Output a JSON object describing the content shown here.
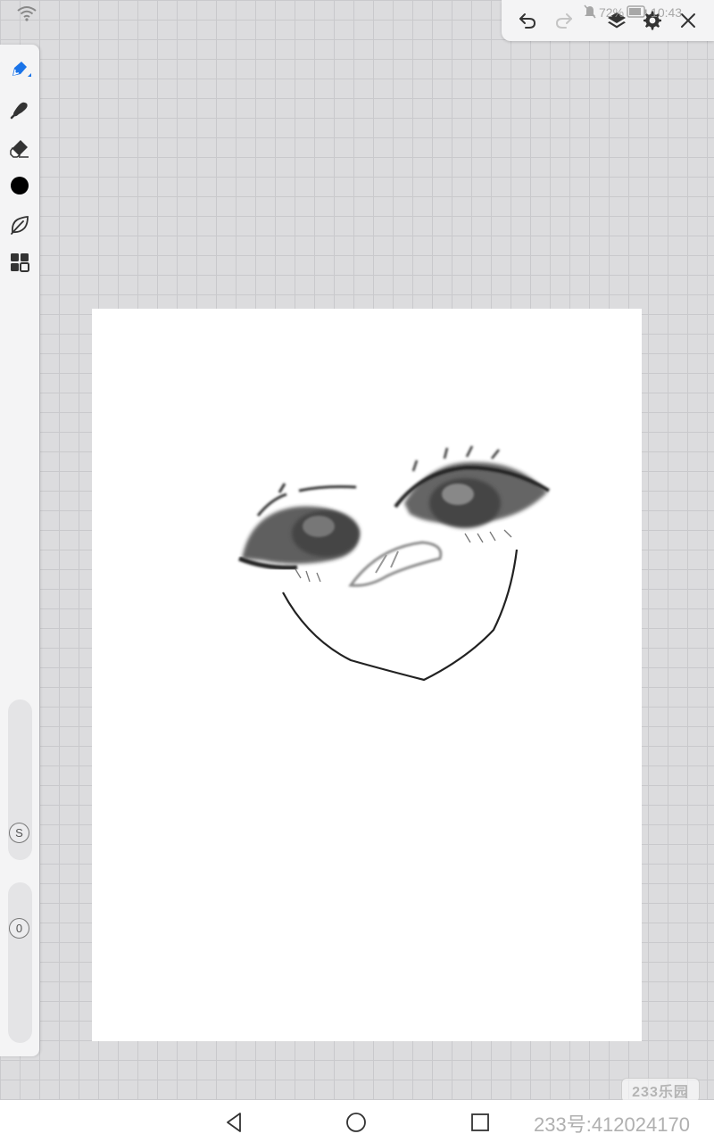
{
  "status_bar": {
    "battery": "72%",
    "time": "10:43"
  },
  "toolbar": {
    "icons": [
      "undo-icon",
      "redo-icon",
      "layers-icon",
      "settings-icon",
      "close-icon"
    ]
  },
  "tools": [
    {
      "name": "pen-tool",
      "icon": "pen-icon",
      "active": true
    },
    {
      "name": "smudge-tool",
      "icon": "smudge-icon",
      "active": false
    },
    {
      "name": "eraser-tool",
      "icon": "eraser-icon",
      "active": false
    },
    {
      "name": "color-picker",
      "icon": "color-dot-icon",
      "color": "#000000"
    },
    {
      "name": "effect-tool",
      "icon": "leaf-icon",
      "active": false
    },
    {
      "name": "gallery-tool",
      "icon": "grid-icon",
      "active": false
    }
  ],
  "sliders": {
    "size_label": "S",
    "opacity_label": "0"
  },
  "colors": {
    "accent": "#1a73e8",
    "canvas": "#ffffff",
    "grid": "#dcdcde"
  },
  "watermark": {
    "logo": "233乐园",
    "id_text": "233号:412024170"
  }
}
